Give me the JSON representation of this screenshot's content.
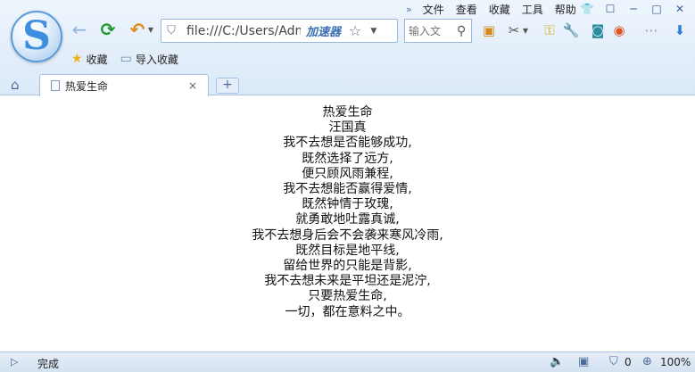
{
  "browser": {
    "logo_letter": "S",
    "menu": [
      "文件",
      "查看",
      "收藏",
      "工具",
      "帮助"
    ],
    "menu_more": "»",
    "address": {
      "url": "file:///C:/Users/Adm",
      "accelerator": "加速器"
    },
    "search": {
      "placeholder": "输入文"
    },
    "favorites": [
      {
        "label": "收藏",
        "icon": "star-icon"
      },
      {
        "label": "导入收藏",
        "icon": "folder-icon"
      }
    ],
    "tab": {
      "title": "热爱生命",
      "close": "×"
    },
    "new_tab": "+"
  },
  "page": {
    "lines": [
      "热爱生命",
      "汪国真",
      "我不去想是否能够成功,",
      "既然选择了远方,",
      "便只顾风雨兼程,",
      "我不去想能否赢得爱情,",
      "既然钟情于玫瑰,",
      "就勇敢地吐露真诚,",
      "我不去想身后会不会袭来寒风冷雨,",
      "既然目标是地平线,",
      "留给世界的只能是背影,",
      "我不去想未来是平坦还是泥泞,",
      "只要热爱生命,",
      "一切，都在意料之中。"
    ]
  },
  "status": {
    "text": "完成",
    "count": "0",
    "zoom": "100%"
  },
  "colors": {
    "chrome_top": "#eef5fd",
    "chrome_bottom": "#dbe9f8",
    "accent": "#3f8fe0",
    "refresh": "#1f9a2e",
    "undo": "#e08a1a"
  }
}
